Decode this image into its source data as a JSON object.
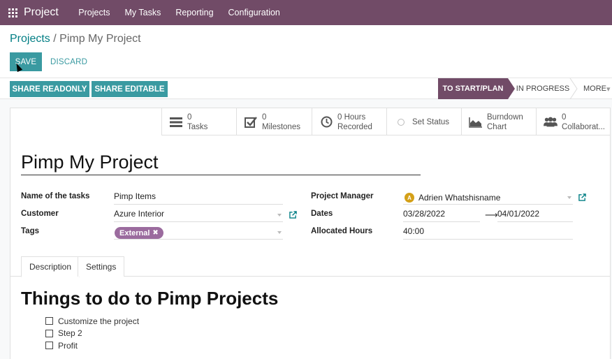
{
  "app": {
    "brand": "Project",
    "nav": [
      "Projects",
      "My Tasks",
      "Reporting",
      "Configuration"
    ]
  },
  "breadcrumb": {
    "parent": "Projects",
    "separator": " / ",
    "current": "Pimp My Project"
  },
  "buttons": {
    "save": "SAVE",
    "discard": "DISCARD",
    "share_readonly": "SHARE READONLY",
    "share_editable": "SHARE EDITABLE"
  },
  "stages": {
    "active": "TO START/PLAN",
    "next": "IN PROGRESS",
    "more": "MORE"
  },
  "smart_buttons": {
    "tasks": {
      "count": "0",
      "label": "Tasks"
    },
    "milestones": {
      "count": "0",
      "label": "Milestones"
    },
    "hours": {
      "count": "0 Hours",
      "label": "Recorded"
    },
    "status": {
      "label": "Set Status"
    },
    "burndown": {
      "line1": "Burndown",
      "line2": "Chart"
    },
    "collaborators": {
      "count": "0",
      "label": "Collaborat..."
    }
  },
  "record": {
    "title": "Pimp My Project"
  },
  "fields": {
    "tasks_name_label": "Name of the tasks",
    "tasks_name_value": "Pimp Items",
    "customer_label": "Customer",
    "customer_value": "Azure Interior",
    "tags_label": "Tags",
    "tag": "External",
    "tag_remove": "✖",
    "manager_label": "Project Manager",
    "manager_initial": "A",
    "manager_value": "Adrien Whatshisname",
    "dates_label": "Dates",
    "date_start": "03/28/2022",
    "date_arrow": "⟶",
    "date_end": "04/01/2022",
    "hours_label": "Allocated Hours",
    "hours_value": "40:00"
  },
  "tabs": [
    "Description",
    "Settings"
  ],
  "description": {
    "title": "Things to do to Pimp Projects",
    "checklist": [
      "Customize the project",
      "Step 2",
      "Profit"
    ]
  },
  "colors": {
    "brand": "#714b67",
    "accent": "#3a9aa1",
    "link": "#017e84",
    "tag": "#9b6b9e"
  }
}
